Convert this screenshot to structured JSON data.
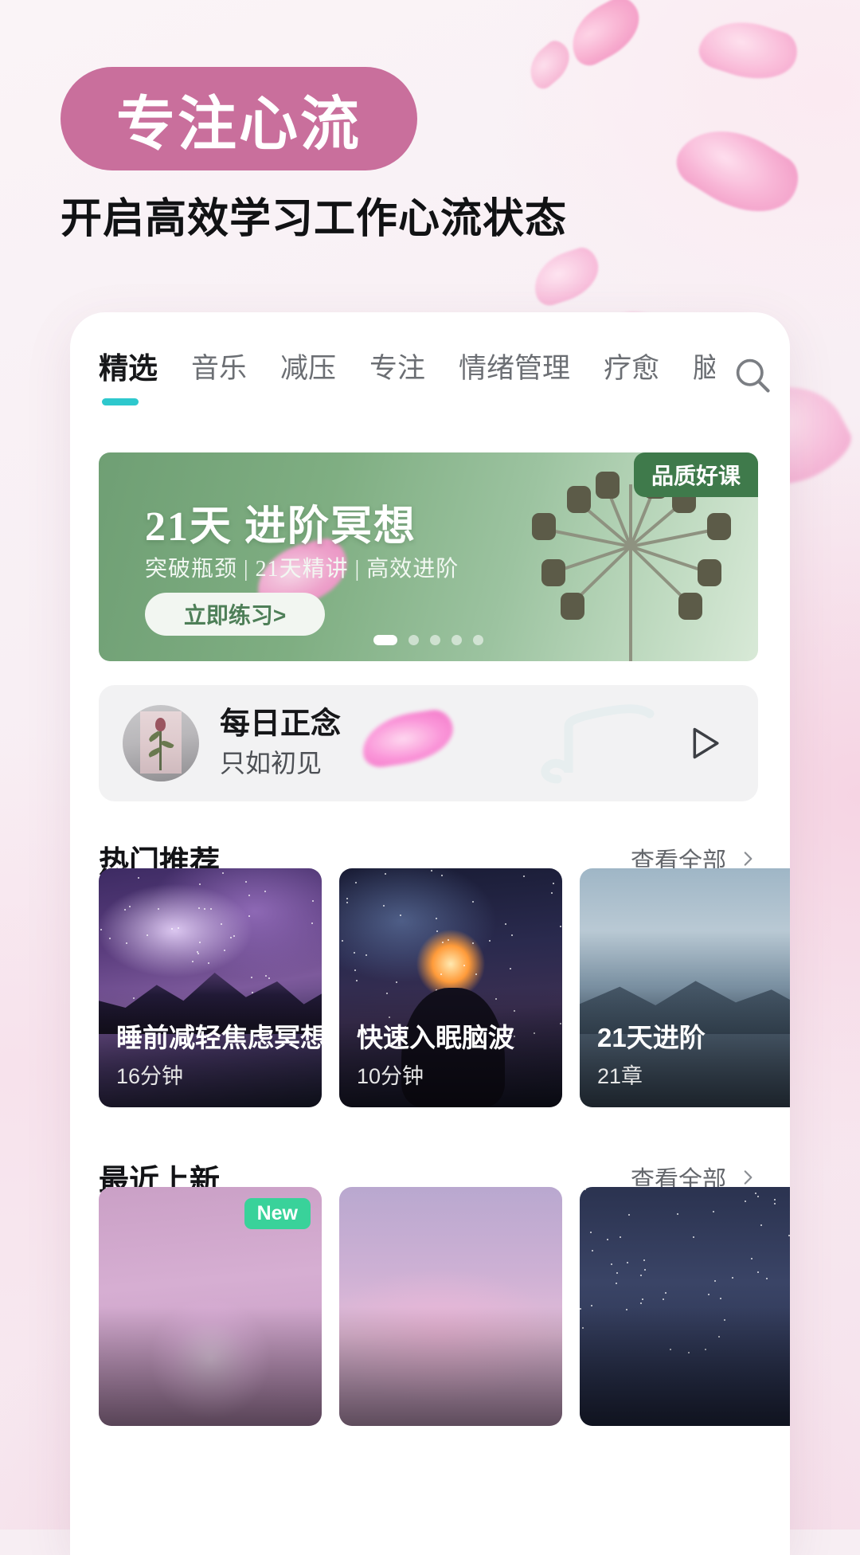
{
  "header": {
    "headline": "专注心流",
    "subheadline": "开启高效学习工作心流状态"
  },
  "colors": {
    "headline_pill": "#c96f9c",
    "tab_accent": "#2ec8cd",
    "section_highlight": "#8fe4e4",
    "banner_green": "#7fae82",
    "badge_green": "#3f7a4b",
    "new_badge": "#39d29a"
  },
  "tabs": {
    "items": [
      {
        "label": "精选",
        "active": true
      },
      {
        "label": "音乐",
        "active": false
      },
      {
        "label": "减压",
        "active": false
      },
      {
        "label": "专注",
        "active": false
      },
      {
        "label": "情绪管理",
        "active": false
      },
      {
        "label": "疗愈",
        "active": false
      },
      {
        "label": "脑",
        "active": false
      }
    ],
    "search_icon": "search-icon"
  },
  "banner": {
    "badge": "品质好课",
    "title": "21天 进阶冥想",
    "subtitle": "突破瓶颈 | 21天精讲 | 高效进阶",
    "cta": "立即练习>",
    "dots_total": 5,
    "dots_active_index": 0
  },
  "daily": {
    "title": "每日正念",
    "subtitle": "只如初见",
    "play_icon": "play-icon",
    "thumb_icon": "rose-photo-thumb"
  },
  "sections": [
    {
      "title": "热门推荐",
      "more_label": "查看全部",
      "more_icon": "chevron-right-icon",
      "cards": [
        {
          "title": "睡前减轻焦虑冥想",
          "meta": "16分钟",
          "art": "art-galaxy1",
          "badge": ""
        },
        {
          "title": "快速入眠脑波",
          "meta": "10分钟",
          "art": "art-galaxy2",
          "badge": ""
        },
        {
          "title": "21天进阶",
          "meta": "21章",
          "art": "art-lake",
          "badge": ""
        }
      ]
    },
    {
      "title": "最近上新",
      "more_label": "查看全部",
      "more_icon": "chevron-right-icon",
      "cards": [
        {
          "title": "",
          "meta": "",
          "art": "art-pink1",
          "badge": "New"
        },
        {
          "title": "",
          "meta": "",
          "art": "art-pink2",
          "badge": ""
        },
        {
          "title": "",
          "meta": "",
          "art": "art-night",
          "badge": ""
        }
      ]
    }
  ]
}
